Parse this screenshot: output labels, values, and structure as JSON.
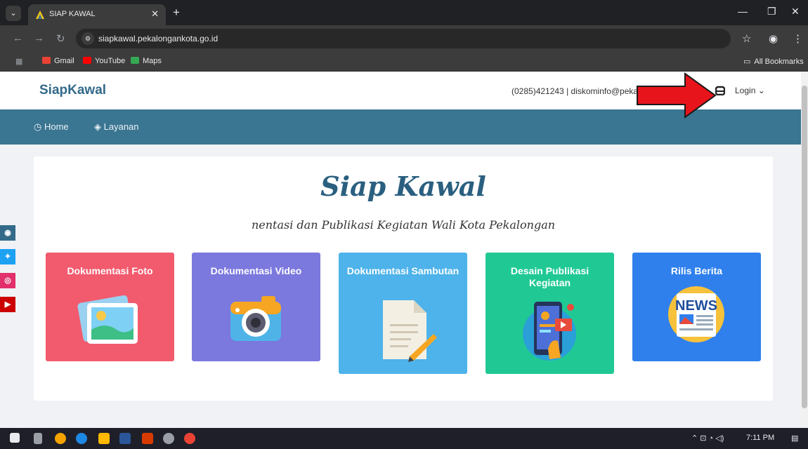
{
  "browser": {
    "tab_title": "SIAP KAWAL",
    "url": "siapkawal.pekalongankota.go.id",
    "bookmarks": [
      {
        "label": "Gmail",
        "icon": "gmail-icon",
        "color": "#ea4335"
      },
      {
        "label": "YouTube",
        "icon": "youtube-icon",
        "color": "#ff0000"
      },
      {
        "label": "Maps",
        "icon": "maps-icon",
        "color": "#34a853"
      }
    ],
    "all_bookmarks": "All Bookmarks"
  },
  "site": {
    "brand": "SiapKawal",
    "contact": "(0285)421243 | diskominfo@peka",
    "login_label": "Login",
    "nav": [
      {
        "label": "Home",
        "icon": "dashboard-icon"
      },
      {
        "label": "Layanan",
        "icon": "layers-icon"
      }
    ]
  },
  "hero": {
    "title": "Siap Kawal",
    "subtitle": "nentasi dan Publikasi Kegiatan Wali Kota Pekalongan"
  },
  "cards": [
    {
      "title": "Dokumentasi Foto",
      "color": "#f25a6e",
      "icon": "photo-icon"
    },
    {
      "title": "Dokumentasi Video",
      "color": "#7b78de",
      "icon": "camera-icon"
    },
    {
      "title": "Dokumentasi Sambutan",
      "color": "#4eb3ea",
      "icon": "document-icon"
    },
    {
      "title": "Desain Publikasi Kegiatan",
      "color": "#20c994",
      "icon": "mobile-publication-icon"
    },
    {
      "title": "Rilis Berita",
      "color": "#2f80ed",
      "icon": "news-icon"
    }
  ],
  "news_art_text": "NEWS",
  "social": [
    {
      "icon": "globe-icon",
      "color": "#336a8a"
    },
    {
      "icon": "twitter-icon",
      "color": "#1da1f2"
    },
    {
      "icon": "instagram-icon",
      "color": "#e1306c"
    },
    {
      "icon": "youtube-icon",
      "color": "#cc0000"
    }
  ],
  "taskbar": {
    "time": "7:11 PM"
  }
}
